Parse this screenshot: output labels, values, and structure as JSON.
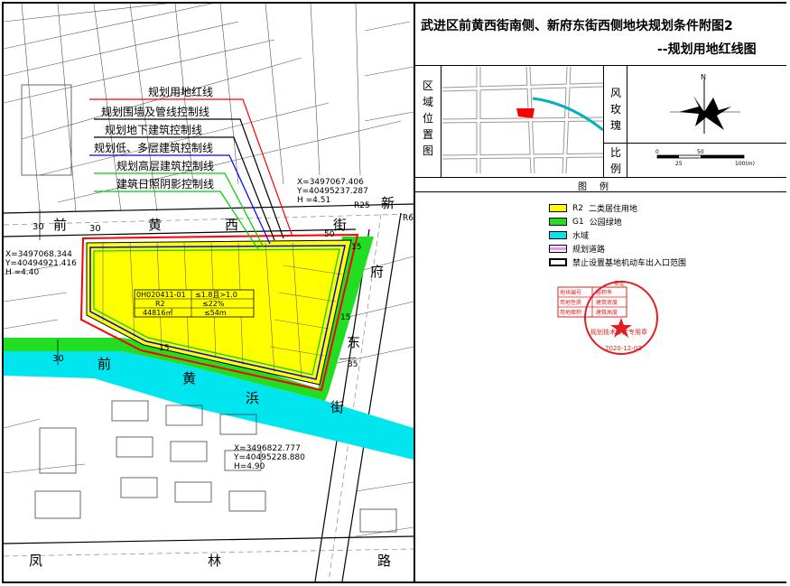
{
  "title": {
    "line1": "武进区前黄西街南侧、新府东街西侧地块规划条件附图2",
    "line2": "--规划用地红线图"
  },
  "location": {
    "label": "区域位置图"
  },
  "wind_rose": {
    "label": "风玫瑰",
    "north": "N"
  },
  "scale": {
    "label": "比例",
    "ticks": [
      "0",
      "25",
      "50",
      "100(m)"
    ]
  },
  "legend": {
    "title": "图例",
    "items": [
      {
        "code": "R2",
        "text": "二类居住用地",
        "color": "#ffff00"
      },
      {
        "code": "G1",
        "text": "公园绿地",
        "color": "#22dd22"
      },
      {
        "code": "",
        "text": "水域",
        "color": "#00e5ee"
      },
      {
        "code": "",
        "text": "规划道路",
        "color": "#ff88ff"
      },
      {
        "code": "",
        "text": "禁止设置基地机动车出入口范围",
        "color": "#ffffff"
      }
    ]
  },
  "stamp": {
    "table": [
      [
        "地块编号",
        "容积率"
      ],
      [
        "用地性质",
        "建筑密度"
      ],
      [
        "用地面积",
        "建筑高度"
      ]
    ],
    "ring_text": "规划技术审定专用章",
    "top_text": "审定",
    "date": "2020-12-03",
    "color": "#e02020"
  },
  "line_legend": [
    {
      "text": "规划用地红线",
      "color": "#ff0000"
    },
    {
      "text": "规划围墙及管线控制线",
      "color": "#000000"
    },
    {
      "text": "规划地下建筑控制线",
      "color": "#000000"
    },
    {
      "text": "规划低、多层建筑控制线",
      "color": "#0000ff"
    },
    {
      "text": "规划高层建筑控制线",
      "color": "#00cc00"
    },
    {
      "text": "建筑日照阴影控制线",
      "color": "#00cc00"
    }
  ],
  "parcel_info": {
    "rows": [
      [
        "0H020411-01",
        "≤1.8且>1.0"
      ],
      [
        "R2",
        "≤22%"
      ],
      [
        "44816㎡",
        "≤54m"
      ]
    ]
  },
  "coords": {
    "c1": [
      "X=3497067.406",
      "Y=40495237.287",
      "H =4.51"
    ],
    "c2": [
      "X=3497068.344",
      "Y=40494921.416",
      "H =4.40"
    ],
    "c3": [
      "X=3496822.777",
      "Y=40495228.880",
      "H=4.90"
    ]
  },
  "dims": {
    "d1": "30",
    "d2": "30",
    "d3": "50",
    "d4": "15",
    "d5": "15",
    "d6": "35",
    "d7": "15",
    "d8": "R25",
    "d9": "R6"
  },
  "streets": {
    "s1": [
      "前",
      "黄",
      "西",
      "街"
    ],
    "s2": [
      "新",
      "府",
      "东",
      "街"
    ],
    "s3": [
      "前",
      "黄",
      "浜"
    ],
    "s4": [
      "凤",
      "林",
      "路"
    ]
  }
}
